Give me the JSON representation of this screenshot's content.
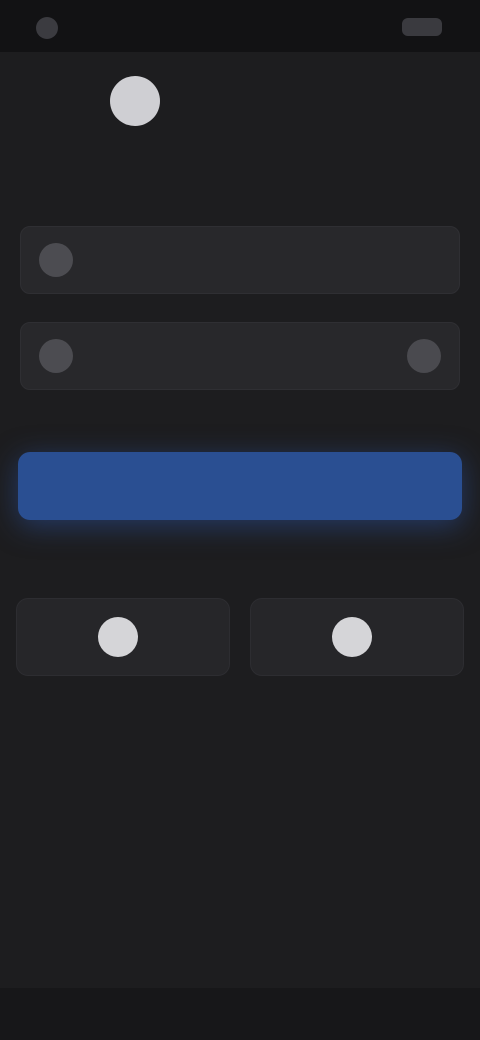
{
  "status_bar": {
    "time": "",
    "battery_icon": "battery-icon"
  },
  "brand": {
    "logo_icon": "app-logo",
    "name": ""
  },
  "title": "",
  "form": {
    "email": {
      "value": "",
      "placeholder": "",
      "icon": "user-icon"
    },
    "password": {
      "value": "",
      "placeholder": "",
      "icon": "lock-icon",
      "toggle_icon": "eye-icon"
    },
    "forgot_label": "",
    "submit_label": ""
  },
  "divider_label": "",
  "social": [
    {
      "label": "",
      "icon": "google-icon"
    },
    {
      "label": "",
      "icon": "apple-icon"
    }
  ],
  "signup": {
    "prompt": "",
    "link": ""
  },
  "terms": {
    "text": "",
    "link": ""
  },
  "colors": {
    "background": "#1d1d1f",
    "accent": "#2a4f92",
    "link": "#3b6cc2"
  }
}
